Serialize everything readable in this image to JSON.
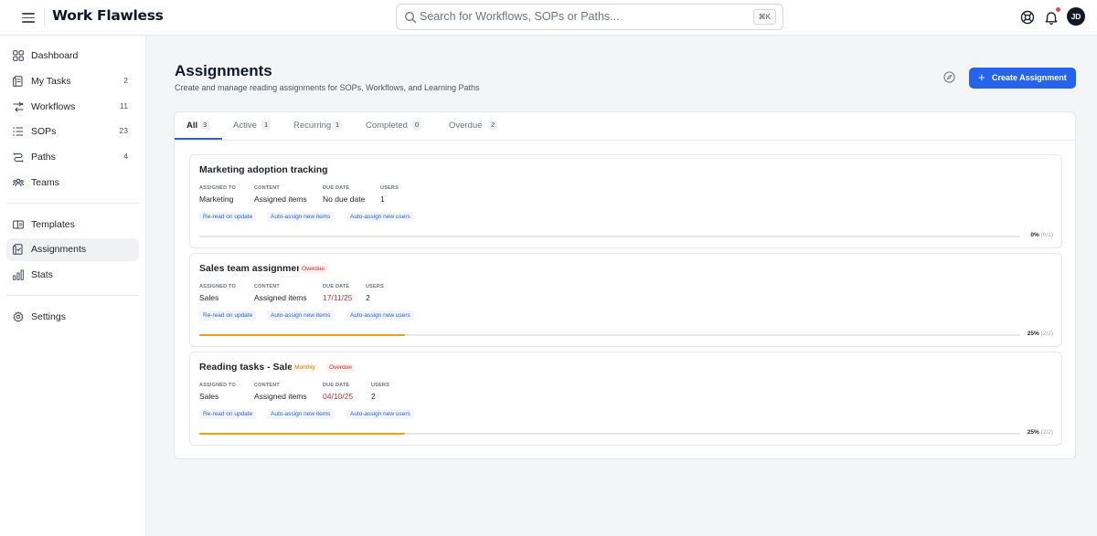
{
  "app": {
    "logo": "Work Flawless",
    "search_placeholder": "Search for Workflows, SOPs or Paths...",
    "search_shortcut": "⌘K",
    "avatar_initials": "JD"
  },
  "sidebar": {
    "items": [
      {
        "label": "Dashboard",
        "count": "",
        "icon": "dashboard-icon"
      },
      {
        "label": "My Tasks",
        "count": "2",
        "icon": "tasks-icon"
      },
      {
        "label": "Workflows",
        "count": "11",
        "icon": "workflows-icon"
      },
      {
        "label": "SOPs",
        "count": "23",
        "icon": "list-icon"
      },
      {
        "label": "Paths",
        "count": "4",
        "icon": "paths-icon"
      },
      {
        "label": "Teams",
        "count": "",
        "icon": "teams-icon"
      },
      {
        "label": "Templates",
        "count": "",
        "icon": "templates-icon"
      },
      {
        "label": "Assignments",
        "count": "",
        "icon": "assignments-icon"
      },
      {
        "label": "Stats",
        "count": "",
        "icon": "stats-icon"
      },
      {
        "label": "Settings",
        "count": "",
        "icon": "gear-icon"
      }
    ],
    "active": "Assignments"
  },
  "page": {
    "title": "Assignments",
    "subtitle": "Create and manage reading assignments for SOPs, Workflows, and Learning Paths",
    "create_label": "Create Assignment"
  },
  "tabs": [
    {
      "label": "All",
      "count": "3"
    },
    {
      "label": "Active",
      "count": "1"
    },
    {
      "label": "Recurring",
      "count": "1"
    },
    {
      "label": "Completed",
      "count": "0"
    },
    {
      "label": "Overdue",
      "count": "2"
    }
  ],
  "field_labels": {
    "assigned_to": "ASSIGNED TO",
    "content": "CONTENT",
    "due_date": "DUE DATE",
    "users": "USERS"
  },
  "assignments": [
    {
      "title": "Marketing adoption tracking",
      "badges": [],
      "assigned_to": "Marketing",
      "content": "Assigned items",
      "due_date": "No due date",
      "due_overdue": false,
      "users": "1",
      "options": [
        "Re-read on update",
        "Auto-assign new items",
        "Auto-assign new users"
      ],
      "progress": 0,
      "progress_pct": "0%",
      "progress_frac": "(0/1)"
    },
    {
      "title": "Sales team assignment",
      "badges": [
        "Overdue"
      ],
      "assigned_to": "Sales",
      "content": "Assigned items",
      "due_date": "17/11/25",
      "due_overdue": true,
      "users": "2",
      "options": [
        "Re-read on update",
        "Auto-assign new items",
        "Auto-assign new users"
      ],
      "progress": 25,
      "progress_pct": "25%",
      "progress_frac": "(2/2)"
    },
    {
      "title": "Reading tasks - Sales",
      "badges": [
        "Monthly",
        "Overdue"
      ],
      "assigned_to": "Sales",
      "content": "Assigned items",
      "due_date": "04/10/25",
      "due_overdue": true,
      "users": "2",
      "options": [
        "Re-read on update",
        "Auto-assign new items",
        "Auto-assign new users"
      ],
      "progress": 25,
      "progress_pct": "25%",
      "progress_frac": "(2/2)"
    }
  ],
  "colors": {
    "accent": "#2563eb",
    "overdue": "#dc2626",
    "monthly": "#d97706",
    "progress": "#f59e0b"
  }
}
